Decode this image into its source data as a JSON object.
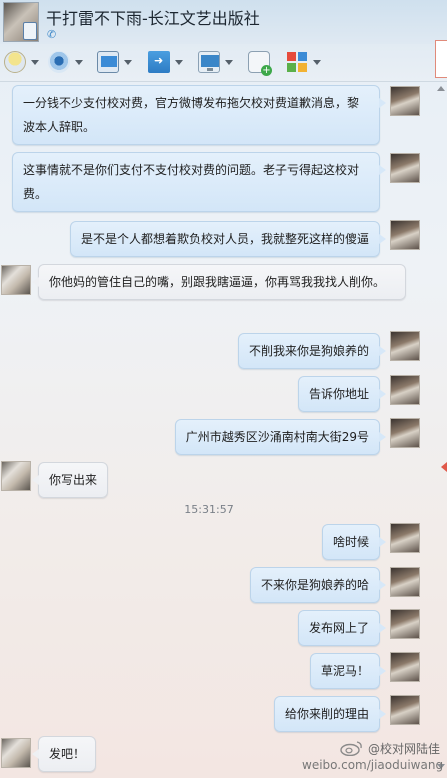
{
  "window": {
    "title": "干打雷不下雨-长江文艺出版社",
    "subtitle_icon": "qq-zone-icon"
  },
  "toolbar": {
    "buttons": [
      {
        "name": "voice-call",
        "icon": "microphone-icon"
      },
      {
        "name": "video-call",
        "icon": "webcam-icon"
      },
      {
        "name": "remote-assist",
        "icon": "screen-chart-icon"
      },
      {
        "name": "send-file",
        "icon": "folder-arrow-icon"
      },
      {
        "name": "remote-desktop",
        "icon": "monitor-icon"
      },
      {
        "name": "create-discussion",
        "icon": "chat-add-icon"
      },
      {
        "name": "apps",
        "icon": "apps-grid-icon"
      }
    ]
  },
  "messages": [
    {
      "side": "right",
      "text": "一分钱不少支付校对费，官方微博发布拖欠校对费道歉消息，黎波本人辞职。"
    },
    {
      "side": "right",
      "text": "这事情就不是你们支付不支付校对费的问题。老子亏得起这校对费。"
    },
    {
      "side": "right",
      "text": "是不是个人都想着欺负校对人员，我就整死这样的傻逼"
    },
    {
      "side": "left",
      "text": "你他妈的管住自己的嘴，别跟我瞎逼逼，你再骂我我找人削你。"
    },
    {
      "side": "right",
      "text": "不削我来你是狗娘养的"
    },
    {
      "side": "right",
      "text": "告诉你地址"
    },
    {
      "side": "right",
      "text": "广州市越秀区沙涌南村南大街29号"
    },
    {
      "side": "left",
      "text": "你写出来"
    },
    {
      "side": "time",
      "text": "15:31:57"
    },
    {
      "side": "right",
      "text": "啥时候"
    },
    {
      "side": "right",
      "text": "不来你是狗娘养的哈"
    },
    {
      "side": "right",
      "text": "发布网上了"
    },
    {
      "side": "right",
      "text": "草泥马！"
    },
    {
      "side": "right",
      "text": "给你来削的理由"
    },
    {
      "side": "left",
      "text": "发吧！"
    }
  ],
  "watermark": {
    "name": "@校对网陆佳",
    "url": "weibo.com/jiaoduiwang"
  },
  "colors": {
    "bubble_right": "#d3e6f8",
    "bubble_left": "#eceef2",
    "link_blue": "#3a86c8"
  }
}
